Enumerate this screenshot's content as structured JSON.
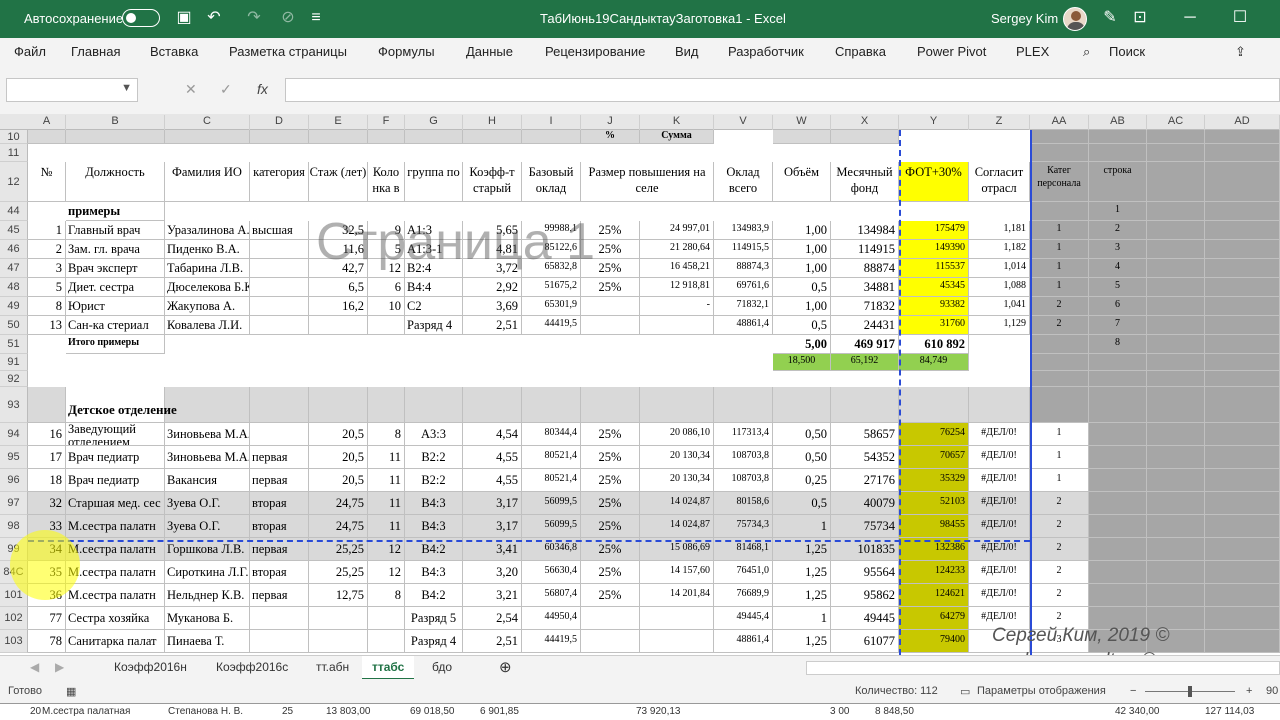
{
  "titlebar": {
    "autosave": "Автосохранение",
    "title": "ТабИюнь19СандыктауЗаготовка1 - Excel",
    "user": "Sergey Kim"
  },
  "menu": [
    "Файл",
    "Главная",
    "Вставка",
    "Разметка страницы",
    "Формулы",
    "Данные",
    "Рецензирование",
    "Вид",
    "Разработчик",
    "Справка",
    "Power Pivot",
    "PLEX",
    "Поиск"
  ],
  "formula_bar": {
    "fx": "fx"
  },
  "columns": [
    "A",
    "B",
    "C",
    "D",
    "E",
    "F",
    "G",
    "H",
    "I",
    "J",
    "K",
    "V",
    "W",
    "X",
    "Y",
    "Z",
    "AA",
    "AB",
    "AC",
    "AD"
  ],
  "row10": {
    "j": "%",
    "k": "Сумма"
  },
  "header": {
    "a": "№",
    "b": "Должность",
    "c": "Фамилия ИО",
    "d": "категория",
    "e": "Стаж (лет)",
    "f": "Коло нка в",
    "g": "группа по",
    "h": "Коэфф-т старый",
    "i": "Базовый оклад",
    "j": "Размер повышения на селе",
    "v": "Оклад всего",
    "w": "Объём",
    "x": "Месячный фонд",
    "y": "ФОТ+30%",
    "z": "Согласит отрасл",
    "aa": "Катег персонала",
    "ab": "строка"
  },
  "row44": {
    "b": "примеры",
    "ab": "1"
  },
  "rows_top": [
    {
      "rn": "45",
      "a": "1",
      "b": "Главный врач",
      "c": "Уразалинова А.",
      "d": "высшая",
      "e": "32,5",
      "f": "9",
      "g": "А1:3",
      "h": "5,65",
      "i": "99988,1",
      "j": "25%",
      "k": "24 997,01",
      "v": "134983,9",
      "w": "1,00",
      "x": "134984",
      "y": "175479",
      "z": "1,181",
      "aa": "1",
      "ab": "2"
    },
    {
      "rn": "46",
      "a": "2",
      "b": "Зам. гл. врача",
      "c": "Пиденко В.А.",
      "d": "",
      "e": "11,6",
      "f": "5",
      "g": "А1:3-1",
      "h": "4,81",
      "i": "85122,6",
      "j": "25%",
      "k": "21 280,64",
      "v": "114915,5",
      "w": "1,00",
      "x": "114915",
      "y": "149390",
      "z": "1,182",
      "aa": "1",
      "ab": "3"
    },
    {
      "rn": "47",
      "a": "3",
      "b": "Врач эксперт",
      "c": "Табарина Л.В.",
      "d": "",
      "e": "42,7",
      "f": "12",
      "g": "В2:4",
      "h": "3,72",
      "i": "65832,8",
      "j": "25%",
      "k": "16 458,21",
      "v": "88874,3",
      "w": "1,00",
      "x": "88874",
      "y": "115537",
      "z": "1,014",
      "aa": "1",
      "ab": "4"
    },
    {
      "rn": "48",
      "a": "5",
      "b": "Диет. сестра",
      "c": "Дюселекова Б.К.",
      "d": "",
      "e": "6,5",
      "f": "6",
      "g": "В4:4",
      "h": "2,92",
      "i": "51675,2",
      "j": "25%",
      "k": "12 918,81",
      "v": "69761,6",
      "w": "0,5",
      "x": "34881",
      "y": "45345",
      "z": "1,088",
      "aa": "1",
      "ab": "5"
    },
    {
      "rn": "49",
      "a": "8",
      "b": "Юрист",
      "c": "Жакупова А.",
      "d": "",
      "e": "16,2",
      "f": "10",
      "g": "С2",
      "h": "3,69",
      "i": "65301,9",
      "j": "",
      "k": "-",
      "v": "71832,1",
      "w": "1,00",
      "x": "71832",
      "y": "93382",
      "z": "1,041",
      "aa": "2",
      "ab": "6"
    },
    {
      "rn": "50",
      "a": "13",
      "b": "Сан-ка стериал",
      "c": "Ковалева Л.И.",
      "d": "",
      "e": "",
      "f": "",
      "g": "Разряд 4",
      "h": "2,51",
      "i": "44419,5",
      "j": "",
      "k": "",
      "v": "48861,4",
      "w": "0,5",
      "x": "24431",
      "y": "31760",
      "z": "1,129",
      "aa": "2",
      "ab": "7"
    }
  ],
  "row51": {
    "b": "Итого примеры",
    "w": "5,00",
    "x": "469 917",
    "y": "610 892",
    "ab": "8"
  },
  "row91": {
    "w": "18,500",
    "x": "65,192",
    "y": "84,749"
  },
  "row93": {
    "b": "Детское отделение"
  },
  "rows_bottom": [
    {
      "rn": "94",
      "a": "16",
      "b": "Заведующий отделением",
      "c": "Зиновьева М.А.",
      "d": "",
      "e": "20,5",
      "f": "8",
      "g": "А3:3",
      "h": "4,54",
      "i": "80344,4",
      "j": "25%",
      "k": "20 086,10",
      "v": "117313,4",
      "w": "0,50",
      "x": "58657",
      "y": "76254",
      "z": "#ДЕЛ/0!",
      "aa": "1"
    },
    {
      "rn": "95",
      "a": "17",
      "b": "Врач педиатр",
      "c": "Зиновьева М.А.",
      "d": "первая",
      "e": "20,5",
      "f": "11",
      "g": "В2:2",
      "h": "4,55",
      "i": "80521,4",
      "j": "25%",
      "k": "20 130,34",
      "v": "108703,8",
      "w": "0,50",
      "x": "54352",
      "y": "70657",
      "z": "#ДЕЛ/0!",
      "aa": "1"
    },
    {
      "rn": "96",
      "a": "18",
      "b": "Врач педиатр",
      "c": "Вакансия",
      "d": "первая",
      "e": "20,5",
      "f": "11",
      "g": "В2:2",
      "h": "4,55",
      "i": "80521,4",
      "j": "25%",
      "k": "20 130,34",
      "v": "108703,8",
      "w": "0,25",
      "x": "27176",
      "y": "35329",
      "z": "#ДЕЛ/0!",
      "aa": "1"
    },
    {
      "rn": "97",
      "a": "32",
      "b": "Старшая мед. сес",
      "c": "Зуева О.Г.",
      "d": "вторая",
      "e": "24,75",
      "f": "11",
      "g": "В4:3",
      "h": "3,17",
      "i": "56099,5",
      "j": "25%",
      "k": "14 024,87",
      "v": "80158,6",
      "w": "0,5",
      "x": "40079",
      "y": "52103",
      "z": "#ДЕЛ/0!",
      "aa": "2"
    },
    {
      "rn": "98",
      "a": "33",
      "b": "М.сестра палатн",
      "c": "Зуева О.Г.",
      "d": "вторая",
      "e": "24,75",
      "f": "11",
      "g": "В4:3",
      "h": "3,17",
      "i": "56099,5",
      "j": "25%",
      "k": "14 024,87",
      "v": "75734,3",
      "w": "1",
      "x": "75734",
      "y": "98455",
      "z": "#ДЕЛ/0!",
      "aa": "2"
    },
    {
      "rn": "99",
      "a": "34",
      "b": "М.сестра палатн",
      "c": "Горшкова Л.В.",
      "d": "первая",
      "e": "25,25",
      "f": "12",
      "g": "В4:2",
      "h": "3,41",
      "i": "60346,8",
      "j": "25%",
      "k": "15 086,69",
      "v": "81468,1",
      "w": "1,25",
      "x": "101835",
      "y": "132386",
      "z": "#ДЕЛ/0!",
      "aa": "2"
    },
    {
      "rn": "84C",
      "a": "35",
      "b": "М.сестра палатн",
      "c": "Сироткина Л.Г.",
      "d": "вторая",
      "e": "25,25",
      "f": "12",
      "g": "В4:3",
      "h": "3,20",
      "i": "56630,4",
      "j": "25%",
      "k": "14 157,60",
      "v": "76451,0",
      "w": "1,25",
      "x": "95564",
      "y": "124233",
      "z": "#ДЕЛ/0!",
      "aa": "2"
    },
    {
      "rn": "101",
      "a": "36",
      "b": "М.сестра палатн",
      "c": "Нельднер К.В.",
      "d": "первая",
      "e": "12,75",
      "f": "8",
      "g": "В4:2",
      "h": "3,21",
      "i": "56807,4",
      "j": "25%",
      "k": "14 201,84",
      "v": "76689,9",
      "w": "1,25",
      "x": "95862",
      "y": "124621",
      "z": "#ДЕЛ/0!",
      "aa": "2"
    },
    {
      "rn": "102",
      "a": "77",
      "b": "Сестра хозяйка",
      "c": "Муканова Б.",
      "d": "",
      "e": "",
      "f": "",
      "g": "Разряд 5",
      "h": "2,54",
      "i": "44950,4",
      "j": "",
      "k": "",
      "v": "49445,4",
      "w": "1",
      "x": "49445",
      "y": "64279",
      "z": "#ДЕЛ/0!",
      "aa": "2"
    },
    {
      "rn": "103",
      "a": "78",
      "b": "Санитарка палат",
      "c": "Пинаева Т.",
      "d": "",
      "e": "",
      "f": "",
      "g": "Разряд 4",
      "h": "2,51",
      "i": "44419,5",
      "j": "",
      "k": "",
      "v": "48861,4",
      "w": "1,25",
      "x": "61077",
      "y": "79400",
      "z": "",
      "aa": "3"
    }
  ],
  "watermark": "Страница 1",
  "signature": {
    "line1": "Сергей Ким, 2019 ©",
    "line2": "zdravconsult.ru ©"
  },
  "sheets": [
    "Коэфф2016н",
    "Коэфф2016с",
    "тт.абн",
    "ттабс",
    "бдо"
  ],
  "active_sheet": "ттабс",
  "status": {
    "ready": "Готово",
    "count": "Количество: 112",
    "display": "Параметры отображения",
    "zoom": "90"
  },
  "bottomrow": {
    "a": "20",
    "b": "М.сестра палатная",
    "c": "Степанова Н. В.",
    "e": "25",
    "i": "13 803,00",
    "k": "69 018,50",
    "v": "6 901,85",
    "x": "73 920,13",
    "y": "3 00",
    "z": "8 848,50",
    "aa": "42 340,00",
    "ad": "127 114,03"
  },
  "colors": {
    "excel_green": "#217346",
    "yellow": "#ffff00",
    "gray": "#a6a6a6"
  }
}
